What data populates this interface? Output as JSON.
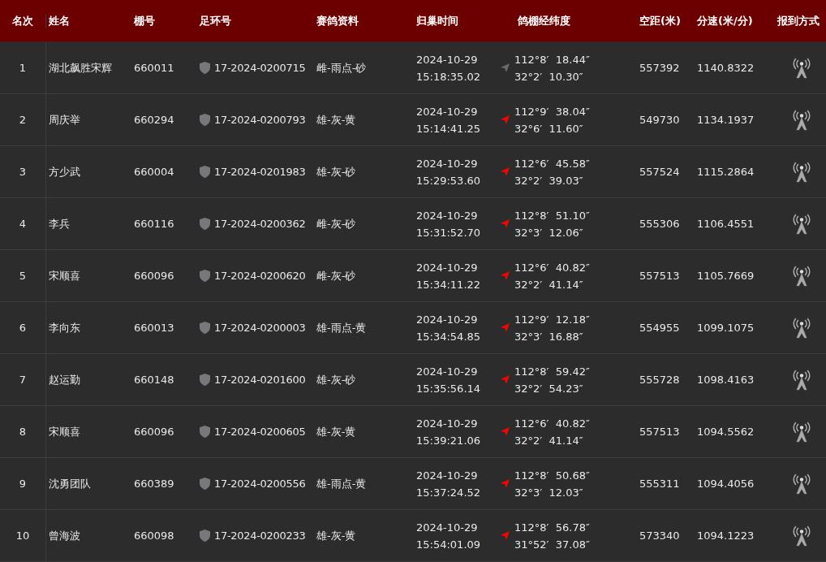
{
  "table": {
    "columns": [
      "名次",
      "姓名",
      "棚号",
      "足环号",
      "赛鸽资料",
      "归巢时间",
      "鸽棚经纬度",
      "空距(米)",
      "分速(米/分)",
      "报到方式"
    ],
    "rows": [
      {
        "rank": "1",
        "name": "湖北飙胜宋辉",
        "loft": "660011",
        "ring": "17-2024-0200715",
        "info": "雌-雨点-砂",
        "date": "2024-10-29",
        "time": "15:18:35.02",
        "color": "#6b6b6b",
        "lon": "112°8′  18.44″",
        "lat": "32°2′  10.30″",
        "distance": "557392",
        "speed": "1140.8322"
      },
      {
        "rank": "2",
        "name": "周庆举",
        "loft": "660294",
        "ring": "17-2024-0200793",
        "info": "雄-灰-黄",
        "date": "2024-10-29",
        "time": "15:14:41.25",
        "color": "#ff0000",
        "lon": "112°9′  38.04″",
        "lat": "32°6′  11.60″",
        "distance": "549730",
        "speed": "1134.1937"
      },
      {
        "rank": "3",
        "name": "方少武",
        "loft": "660004",
        "ring": "17-2024-0201983",
        "info": "雄-灰-砂",
        "date": "2024-10-29",
        "time": "15:29:53.60",
        "color": "#ff0000",
        "lon": "112°6′  45.58″",
        "lat": "32°2′  39.03″",
        "distance": "557524",
        "speed": "1115.2864"
      },
      {
        "rank": "4",
        "name": "李兵",
        "loft": "660116",
        "ring": "17-2024-0200362",
        "info": "雌-灰-砂",
        "date": "2024-10-29",
        "time": "15:31:52.70",
        "color": "#ff0000",
        "lon": "112°8′  51.10″",
        "lat": "32°3′  12.06″",
        "distance": "555306",
        "speed": "1106.4551"
      },
      {
        "rank": "5",
        "name": "宋顺喜",
        "loft": "660096",
        "ring": "17-2024-0200620",
        "info": "雌-灰-砂",
        "date": "2024-10-29",
        "time": "15:34:11.22",
        "color": "#ff0000",
        "lon": "112°6′  40.82″",
        "lat": "32°2′  41.14″",
        "distance": "557513",
        "speed": "1105.7669"
      },
      {
        "rank": "6",
        "name": "李向东",
        "loft": "660013",
        "ring": "17-2024-0200003",
        "info": "雄-雨点-黄",
        "date": "2024-10-29",
        "time": "15:34:54.85",
        "color": "#ff0000",
        "lon": "112°9′  12.18″",
        "lat": "32°3′  16.88″",
        "distance": "554955",
        "speed": "1099.1075"
      },
      {
        "rank": "7",
        "name": "赵运勤",
        "loft": "660148",
        "ring": "17-2024-0201600",
        "info": "雄-灰-砂",
        "date": "2024-10-29",
        "time": "15:35:56.14",
        "color": "#ff0000",
        "lon": "112°8′  59.42″",
        "lat": "32°2′  54.23″",
        "distance": "555728",
        "speed": "1098.4163"
      },
      {
        "rank": "8",
        "name": "宋顺喜",
        "loft": "660096",
        "ring": "17-2024-0200605",
        "info": "雄-灰-黄",
        "date": "2024-10-29",
        "time": "15:39:21.06",
        "color": "#ff0000",
        "lon": "112°6′  40.82″",
        "lat": "32°2′  41.14″",
        "distance": "557513",
        "speed": "1094.5562"
      },
      {
        "rank": "9",
        "name": "沈勇团队",
        "loft": "660389",
        "ring": "17-2024-0200556",
        "info": "雄-雨点-黄",
        "date": "2024-10-29",
        "time": "15:37:24.52",
        "color": "#ff0000",
        "lon": "112°8′  50.68″",
        "lat": "32°3′  12.03″",
        "distance": "555311",
        "speed": "1094.4056"
      },
      {
        "rank": "10",
        "name": "曾海波",
        "loft": "660098",
        "ring": "17-2024-0200233",
        "info": "雄-灰-黄",
        "date": "2024-10-29",
        "time": "15:54:01.09",
        "color": "#ff0000",
        "lon": "112°8′  56.78″",
        "lat": "31°52′  37.08″",
        "distance": "573340",
        "speed": "1094.1223"
      }
    ]
  }
}
